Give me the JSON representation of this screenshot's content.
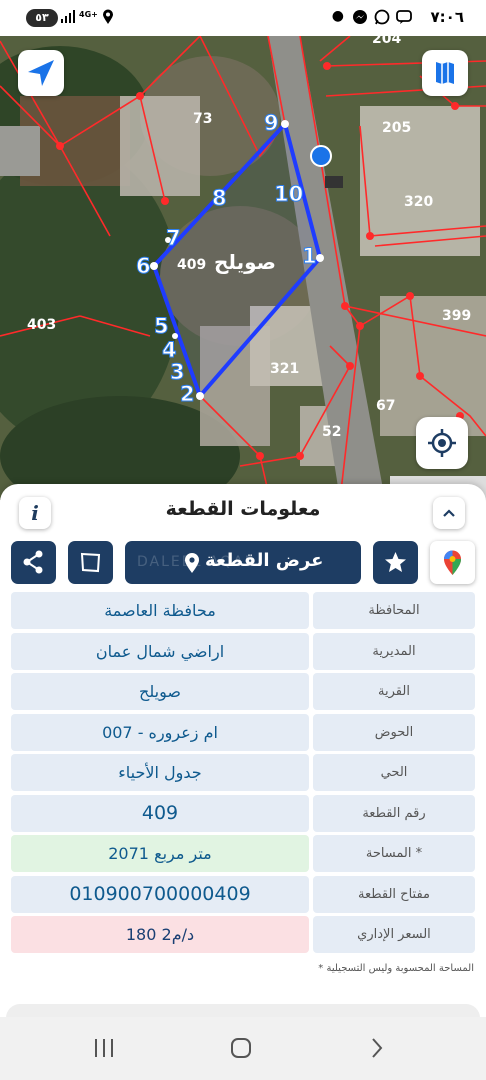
{
  "status_bar": {
    "time": "٧:٠٦",
    "battery": "٥٣",
    "network": "4G+"
  },
  "map": {
    "parcel_number": "409",
    "village_name": "صويلح",
    "neighbor_numbers": [
      "73",
      "403",
      "321",
      "52",
      "67",
      "399",
      "320",
      "205",
      "204"
    ],
    "vertex_labels": [
      "1",
      "2",
      "3",
      "4",
      "5",
      "6",
      "7",
      "8",
      "9",
      "10"
    ],
    "colors": {
      "parcel_outline": "#1f3cff",
      "boundaries": "#ff2a2a",
      "vertex_badge": "#2d7ff0"
    }
  },
  "sheet": {
    "title": "معلومات القطعة",
    "info_label": "i",
    "actions": {
      "show_parcel": "عرض القطعة",
      "watermark": "DALEEL AQAR"
    },
    "rows": [
      {
        "label": "المحافظة",
        "value": "محافظة العاصمة"
      },
      {
        "label": "المديرية",
        "value": "اراضي شمال عمان"
      },
      {
        "label": "القرية",
        "value": "صويلح"
      },
      {
        "label": "الحوض",
        "value": "ام زعروره - 007"
      },
      {
        "label": "الحي",
        "value": "جدول الأحياء"
      },
      {
        "label": "رقم القطعة",
        "value": "409"
      },
      {
        "label": "المساحة *",
        "value": "2071 متر مربع"
      },
      {
        "label": "مفتاح القطعة",
        "value": "010900700000409"
      },
      {
        "label": "السعر الإداري",
        "value": "180 د/م2"
      }
    ],
    "footnote": "* المساحة المحسوبة وليس التسجيلية"
  },
  "colors": {
    "primary": "#1e3d63",
    "row_bg": "#e5ecf5",
    "area_bg": "#e1f4e2",
    "price_bg": "#fbe0e3",
    "value_text": "#0f5a8e"
  }
}
